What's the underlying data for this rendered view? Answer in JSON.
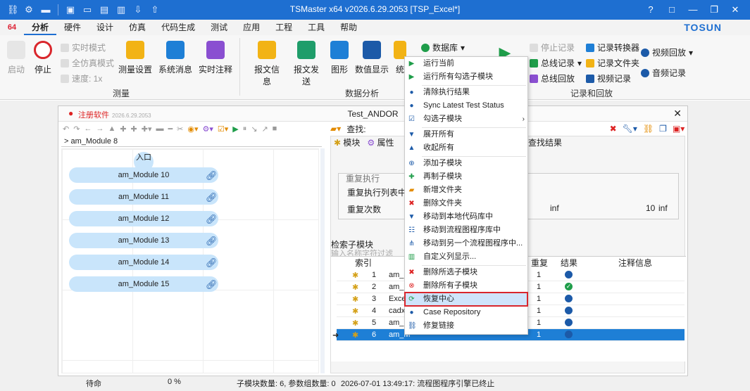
{
  "window": {
    "title": "TSMaster x64 v2026.6.29.2053 [TSP_Excel*]",
    "buttons": [
      "?",
      "□",
      "—",
      "❐",
      "✕"
    ]
  },
  "menu": {
    "logo": "64",
    "items": [
      "分析",
      "硬件",
      "设计",
      "仿真",
      "代码生成",
      "测试",
      "应用",
      "工程",
      "工具",
      "帮助"
    ],
    "active": "分析",
    "brand": "TOSUN"
  },
  "ribbon": {
    "start": "启动",
    "stop": "停止",
    "realtime": "实时模式",
    "fullsim": "全仿真模式",
    "speed": "速度: 1x",
    "measure_settings": "测量设置",
    "sys_msg": "系统消息",
    "rt_note": "实时注释",
    "group_measure": "测量",
    "msg_info": "报文信息",
    "msg_send": "报文发送",
    "graph": "图形",
    "num_display": "数值显示",
    "stats": "统",
    "database": "数据库",
    "group_analysis": "数据分析",
    "stop_record": "停止记录",
    "bus_record": "总线记录",
    "bus_replay": "总线回放",
    "log_converter": "记录转换器",
    "log_folder": "记录文件夹",
    "video_record": "视频记录",
    "video_replay": "视频回放",
    "audio_record": "音频记录",
    "group_record": "记录和回放"
  },
  "child": {
    "register": "注册软件",
    "register_ver": "2026.6.29.2053",
    "title": "Test_ANDOR",
    "breadcrumb": "> am_Module 8",
    "search_label": "查找:",
    "entry": "入口",
    "nodes": [
      "am_Module 10",
      "am_Module 11",
      "am_Module 12",
      "am_Module 13",
      "am_Module 14",
      "am_Module 15"
    ]
  },
  "panel": {
    "tab_module": "模块",
    "tab_props": "属性",
    "tab_find": "查找结果",
    "group_title": "重复执行",
    "repeat_list": "重复执行列表中选",
    "repeat_count": "重复次数",
    "inf1": "inf",
    "ten": "10",
    "inf2": "inf",
    "search_sub": "检索子模块",
    "filter_hint": "输入名称字符过滤",
    "col_index": "索引",
    "col_repeat": "重复",
    "col_result": "结果",
    "col_note": "注释信息",
    "rows": [
      {
        "idx": "1",
        "name": "am_M",
        "rep": "1",
        "result": "dot"
      },
      {
        "idx": "2",
        "name": "am_M",
        "rep": "1",
        "result": "ok"
      },
      {
        "idx": "3",
        "name": "Excel",
        "rep": "1",
        "result": "dot"
      },
      {
        "idx": "4",
        "name": "cadx",
        "rep": "1",
        "result": "dot"
      },
      {
        "idx": "5",
        "name": "am_M",
        "rep": "1",
        "result": "dot"
      },
      {
        "idx": "6",
        "name": "am_M",
        "rep": "1",
        "result": "dot"
      }
    ]
  },
  "status": {
    "state": "待命",
    "percent": "0 %",
    "counts": "子模块数量: 6, 参数组数量: 0",
    "log": "2026-07-01 13:49:17: 流程图程序引擎已终止"
  },
  "context_menu": {
    "items": [
      "运行当前",
      "运行所有勾选子模块",
      "清除执行结果",
      "Sync Latest Test Status",
      "勾选子模块",
      "展开所有",
      "收起所有",
      "添加子模块",
      "再制子模块",
      "新增文件夹",
      "删除文件夹",
      "移动到本地代码库中",
      "移动到流程图程序库中",
      "移动到另一个流程图程序中...",
      "自定义列显示...",
      "删除所选子模块",
      "删除所有子模块",
      "恢复中心",
      "Case Repository",
      "修复链接"
    ],
    "highlighted": "恢复中心"
  }
}
